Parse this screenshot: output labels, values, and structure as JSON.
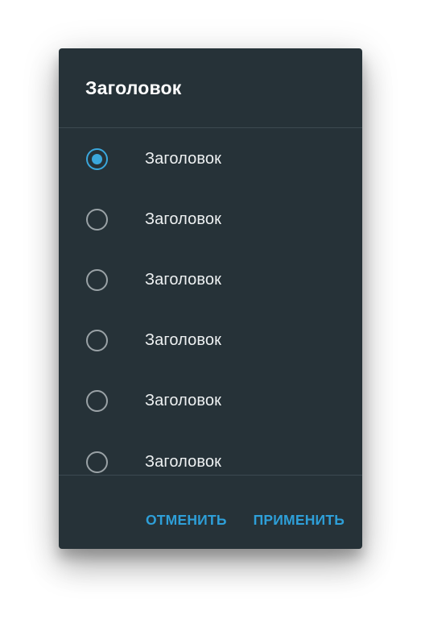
{
  "dialog": {
    "title": "Заголовок",
    "options": [
      {
        "label": "Заголовок",
        "selected": true
      },
      {
        "label": "Заголовок",
        "selected": false
      },
      {
        "label": "Заголовок",
        "selected": false
      },
      {
        "label": "Заголовок",
        "selected": false
      },
      {
        "label": "Заголовок",
        "selected": false
      },
      {
        "label": "Заголовок",
        "selected": false
      }
    ],
    "cancel_label": "ОТМЕНИТЬ",
    "apply_label": "ПРИМЕНИТЬ"
  },
  "colors": {
    "dialog_background": "#263238",
    "accent": "#2e9fd8",
    "radio_unchecked": "#9aa2a6"
  }
}
